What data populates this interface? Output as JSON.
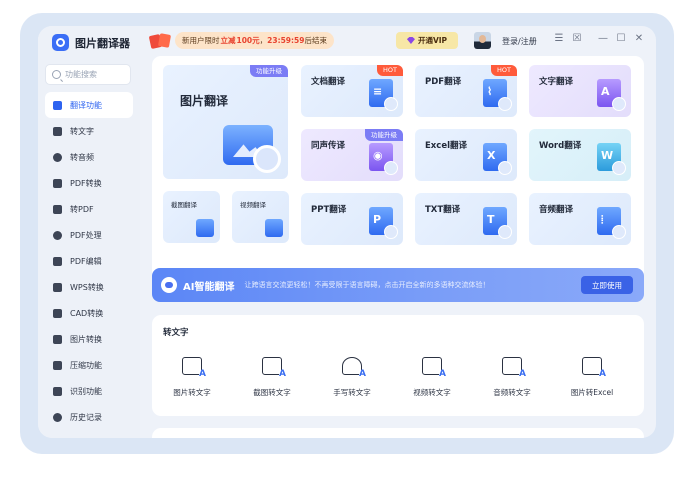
{
  "app": {
    "name": "图片翻译器"
  },
  "search": {
    "placeholder": "功能搜索"
  },
  "sidebar": {
    "items": [
      {
        "label": "翻译功能",
        "active": true
      },
      {
        "label": "转文字"
      },
      {
        "label": "转音频"
      },
      {
        "label": "PDF转换"
      },
      {
        "label": "转PDF"
      },
      {
        "label": "PDF处理"
      },
      {
        "label": "PDF编辑"
      },
      {
        "label": "WPS转换"
      },
      {
        "label": "CAD转换"
      },
      {
        "label": "图片转换"
      },
      {
        "label": "压缩功能"
      },
      {
        "label": "识别功能"
      },
      {
        "label": "历史记录"
      }
    ]
  },
  "topbar": {
    "promo_prefix": "新用户限时",
    "promo_highlight": "立减",
    "promo_amount": "100元",
    "promo_sep": "，",
    "promo_timer": "23:59:59",
    "promo_suffix": "后结束",
    "vip_label": "开通VIP",
    "login_label": "登录/注册"
  },
  "features": {
    "big": {
      "label": "图片翻译",
      "tag": "功能升级"
    },
    "screenshot": {
      "label": "截图翻译"
    },
    "video": {
      "label": "视频翻译"
    },
    "doc": {
      "label": "文档翻译",
      "tag": "HOT"
    },
    "pdf": {
      "label": "PDF翻译",
      "tag": "HOT"
    },
    "text": {
      "label": "文字翻译"
    },
    "simul": {
      "label": "同声传译",
      "tag": "功能升级"
    },
    "excel": {
      "label": "Excel翻译"
    },
    "word": {
      "label": "Word翻译"
    },
    "ppt": {
      "label": "PPT翻译"
    },
    "txt": {
      "label": "TXT翻译"
    },
    "audio": {
      "label": "音频翻译"
    }
  },
  "banner": {
    "title": "AI智能翻译",
    "desc": "让跨语言交流更轻松！不再受限于语言障碍，点击开启全新的多语种交流体验！",
    "button": "立即使用"
  },
  "to_text": {
    "title": "转文字",
    "tools": [
      {
        "label": "图片转文字"
      },
      {
        "label": "截图转文字"
      },
      {
        "label": "手写转文字"
      },
      {
        "label": "视频转文字"
      },
      {
        "label": "音频转文字"
      },
      {
        "label": "图片转Excel"
      }
    ]
  },
  "colors": {
    "accent": "#2d63f0",
    "hot": "#ff5b3b",
    "upgrade": "#7b7cf5",
    "promo": "#e8432f"
  }
}
